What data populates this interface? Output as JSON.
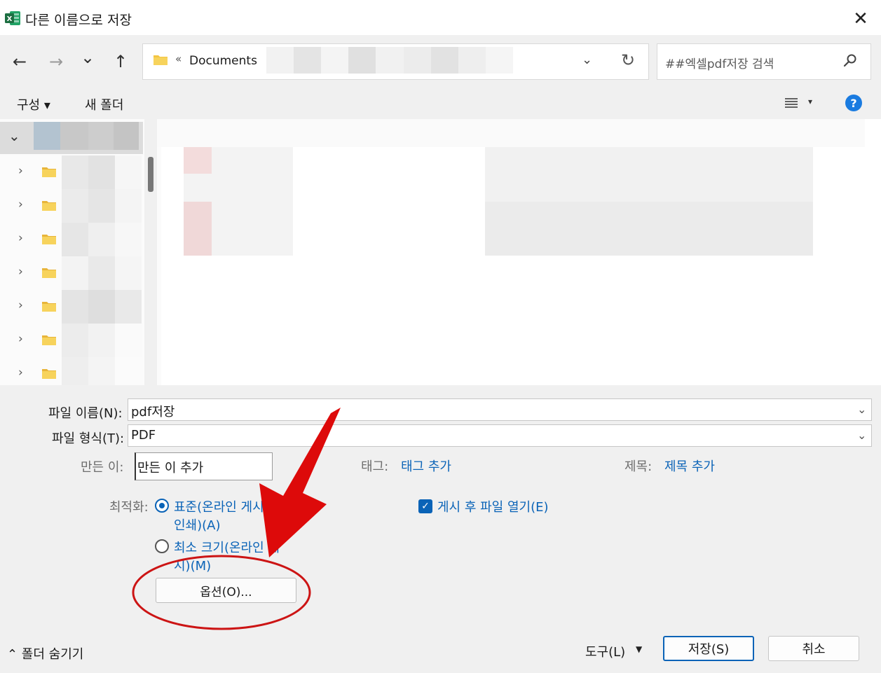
{
  "window": {
    "title": "다른 이름으로 저장",
    "close_glyph": "✕"
  },
  "nav": {
    "back_glyph": "←",
    "forward_glyph": "→",
    "recent_glyph": "⌄",
    "up_glyph": "↑",
    "address": {
      "chevron": "«",
      "path_root": "Documents",
      "dropdown_glyph": "⌄",
      "refresh_glyph": "↻"
    },
    "search": {
      "placeholder": "##엑셀pdf저장 검색"
    }
  },
  "commands": {
    "organize": "구성 ▾",
    "new_folder": "새 폴더",
    "view_drop": "▾",
    "help": "?"
  },
  "tree": {
    "root_chevron": "⌄",
    "item_chevron": "›",
    "folder_count": 7
  },
  "form": {
    "filename_label": "파일 이름(N):",
    "filename_value": "pdf저장",
    "filetype_label": "파일 형식(T):",
    "filetype_value": "PDF",
    "dropdown_glyph": "⌄",
    "author_label": "만든 이:",
    "author_value": "만든 이 추가",
    "tags_label": "태그:",
    "tags_link": "태그 추가",
    "subject_label": "제목:",
    "subject_link": "제목 추가",
    "optimize_label": "최적화:",
    "radio_standard_line1": "표준(온라인 게시",
    "radio_standard_line2": "인쇄)(A)",
    "radio_min_line1": "최소 크기(온라인 게",
    "radio_min_line2": "시)(M)",
    "radio_selected": "standard",
    "open_after_publish": "게시 후 파일 열기(E)",
    "open_after_publish_checked": true,
    "checkbox_glyph": "✓",
    "options_button": "옵션(O)..."
  },
  "footer": {
    "hide_folders": "⌃ 폴더 숨기기",
    "tools": "도구(L)",
    "tools_drop": "▼",
    "save": "저장(S)",
    "cancel": "취소"
  },
  "annotation": {
    "arrow_color": "#dd0a0a",
    "ellipse_color": "#cc1414"
  },
  "colors": {
    "accent": "#0a63b7",
    "excel_green": "#1d6f42",
    "folder_yellow": "#f4c542"
  }
}
